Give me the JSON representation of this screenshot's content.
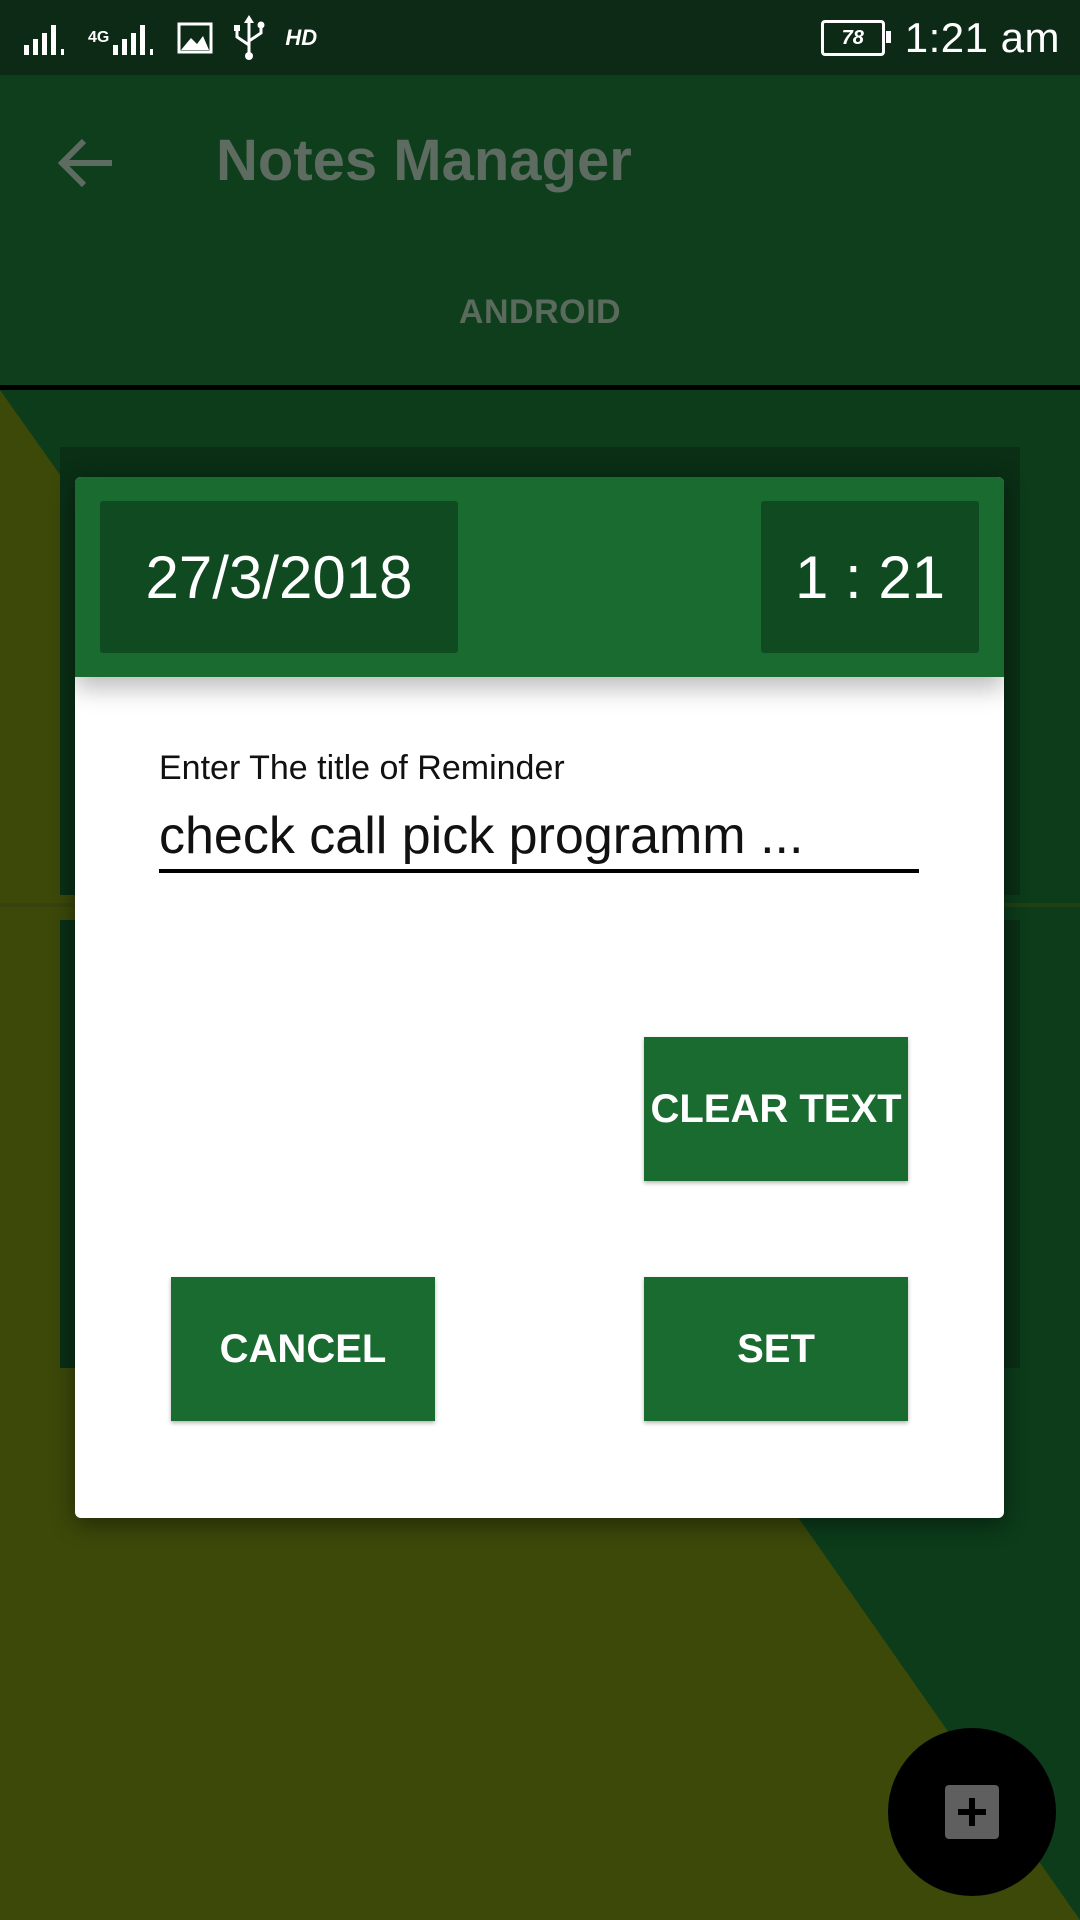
{
  "status_bar": {
    "network_type": "4G",
    "hd_label": "HD",
    "battery_level": "78",
    "time": "1:21 am"
  },
  "toolbar": {
    "title": "Notes Manager",
    "tab": "ANDROID"
  },
  "dialog": {
    "date": "27/3/2018",
    "time": "1 : 21",
    "field_label": "Enter The title of Reminder",
    "title_value": "check call pick programm ...",
    "clear_button": "CLEAR TEXT",
    "cancel_button": "CANCEL",
    "set_button": "SET"
  },
  "icons": {
    "back": "arrow-left-icon",
    "fab": "plus-icon"
  },
  "colors": {
    "status_bar_bg": "#0c2a15",
    "toolbar_bg": "#0e3e1c",
    "accent_green": "#1a6b30",
    "dark_green": "#104a21",
    "olive": "#4a5a0c"
  }
}
